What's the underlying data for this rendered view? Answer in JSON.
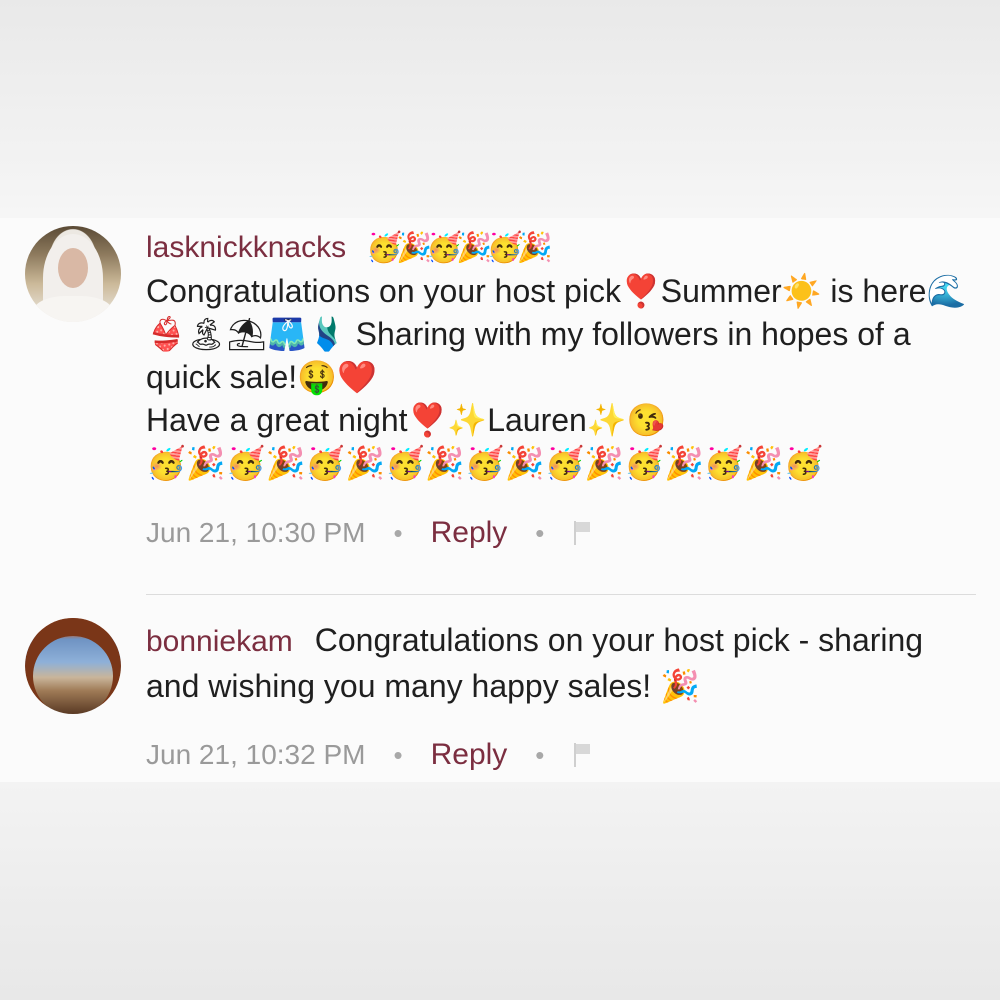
{
  "comments": [
    {
      "username": "lasknickknacks",
      "username_emoji": "🥳🎉🥳🎉🥳🎉",
      "text": "Congratulations on your host pick❣️Summer☀️ is here🌊👙🏝⛱🩳🩱 Sharing with my followers in hopes of a quick sale!🤑❤️\nHave a great night❣️✨Lauren✨😘\n🥳🎉🥳🎉🥳🎉🥳🎉🥳🎉🥳🎉🥳🎉🥳🎉🥳",
      "timestamp": "Jun 21, 10:30 PM",
      "reply_label": "Reply",
      "separator": "•"
    },
    {
      "username": "bonniekam",
      "text": "Congratulations on your host pick - sharing and wishing you many happy sales! 🎉",
      "timestamp": "Jun 21, 10:32 PM",
      "reply_label": "Reply",
      "separator": "•"
    }
  ],
  "colors": {
    "username": "#7b2e40",
    "reply": "#7b2e40",
    "meta": "#9a9a9a",
    "text": "#1f1f1f"
  }
}
